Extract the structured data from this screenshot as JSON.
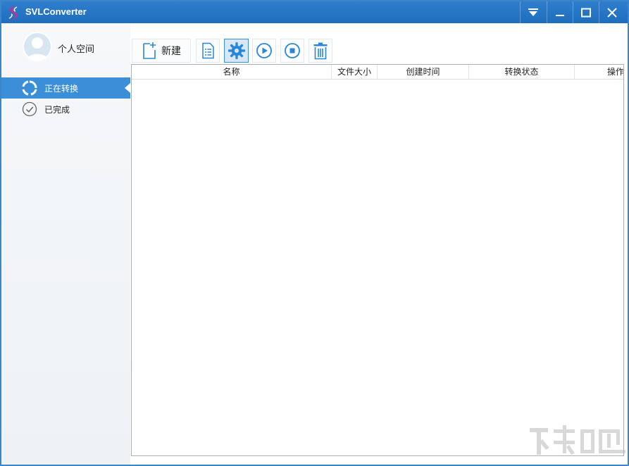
{
  "window": {
    "title": "SVLConverter"
  },
  "titlebar": {
    "menu_icon": "dropdown-menu-icon",
    "minimize_icon": "minimize-icon",
    "maximize_icon": "maximize-icon",
    "close_icon": "close-icon"
  },
  "sidebar": {
    "user_label": "个人空间",
    "items": [
      {
        "label": "正在转换",
        "icon": "converting-icon",
        "active": true
      },
      {
        "label": "已完成",
        "icon": "check-circle-icon",
        "active": false
      }
    ]
  },
  "toolbar": {
    "new_label": "新建",
    "buttons": [
      "new-file-icon",
      "list-icon",
      "gear-icon",
      "play-icon",
      "stop-icon",
      "trash-icon"
    ]
  },
  "table": {
    "columns": [
      "名称",
      "文件大小",
      "创建时间",
      "转换状态",
      "操作"
    ],
    "rows": []
  },
  "colors": {
    "titlebar": "#2a7ac9",
    "accent": "#3b8fd9",
    "icon": "#2b86d6"
  }
}
